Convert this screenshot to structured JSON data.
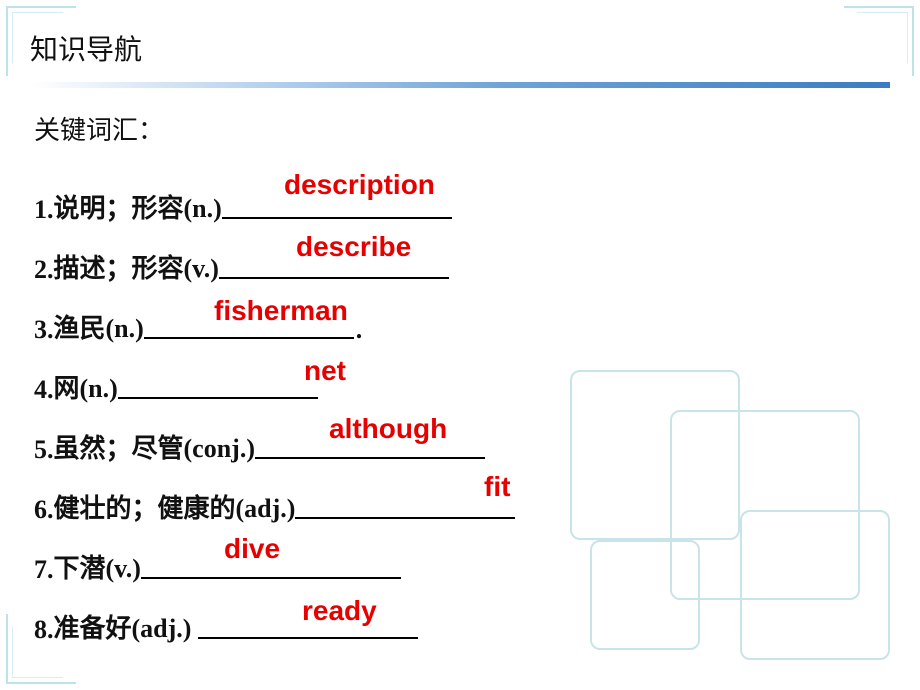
{
  "nav_title": "知识导航",
  "section_heading": "关键词汇：",
  "items": [
    {
      "num": "1.",
      "prompt": "说明；形容(n.)",
      "answer": "description",
      "trail": ""
    },
    {
      "num": "2.",
      "prompt": "描述；形容(v.)",
      "answer": "describe",
      "trail": ""
    },
    {
      "num": "3.",
      "prompt": "渔民(n.)",
      "answer": "fisherman",
      "trail": "."
    },
    {
      "num": "4.",
      "prompt": "网(n.)",
      "answer": "net",
      "trail": ""
    },
    {
      "num": "5.",
      "prompt": "虽然；尽管(conj.)",
      "answer": "although",
      "trail": ""
    },
    {
      "num": "6.",
      "prompt": "健壮的；健康的(adj.)",
      "answer": "fit",
      "trail": ""
    },
    {
      "num": "7.",
      "prompt": "下潜(v.)",
      "answer": "dive",
      "trail": ""
    },
    {
      "num": "8.",
      "prompt": "准备好(adj.) ",
      "answer": "ready",
      "trail": ""
    }
  ]
}
